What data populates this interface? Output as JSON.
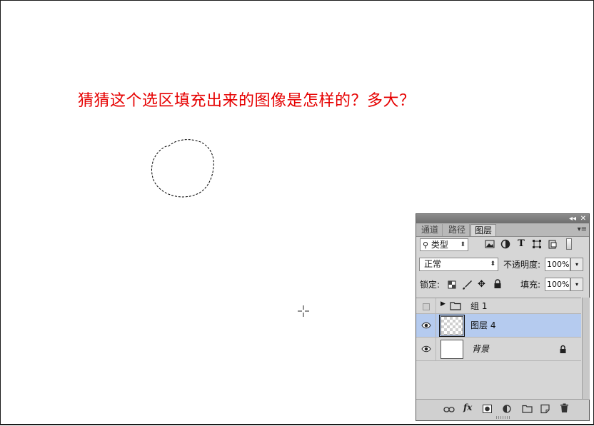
{
  "canvas": {
    "question": "猜猜这个选区填充出来的图像是怎样的？多大？",
    "question_color": "#e60000"
  },
  "panel": {
    "collapse_icon": "◂◂",
    "close_icon": "✕",
    "menu_icon": "▾≡",
    "tabs": [
      {
        "label": "通道",
        "active": false
      },
      {
        "label": "路径",
        "active": false
      },
      {
        "label": "图层",
        "active": true
      }
    ],
    "filter": {
      "kind_label": "类型",
      "icons": [
        "image-filter-icon",
        "adjustment-filter-icon",
        "type-filter-icon",
        "shape-filter-icon",
        "smart-object-filter-icon"
      ]
    },
    "blend_mode": "正常",
    "opacity_label": "不透明度:",
    "opacity_value": "100%",
    "lock_label": "锁定:",
    "fill_label": "填充:",
    "fill_value": "100%",
    "layers": [
      {
        "name": "组 1",
        "type": "group",
        "visible": false,
        "selected": false
      },
      {
        "name": "图层 4",
        "type": "layer",
        "visible": true,
        "selected": true
      },
      {
        "name": "背景",
        "type": "background",
        "visible": true,
        "selected": false,
        "locked": true
      }
    ],
    "selected_color": "#b5cbef",
    "bottom_fx_label": "fx"
  }
}
